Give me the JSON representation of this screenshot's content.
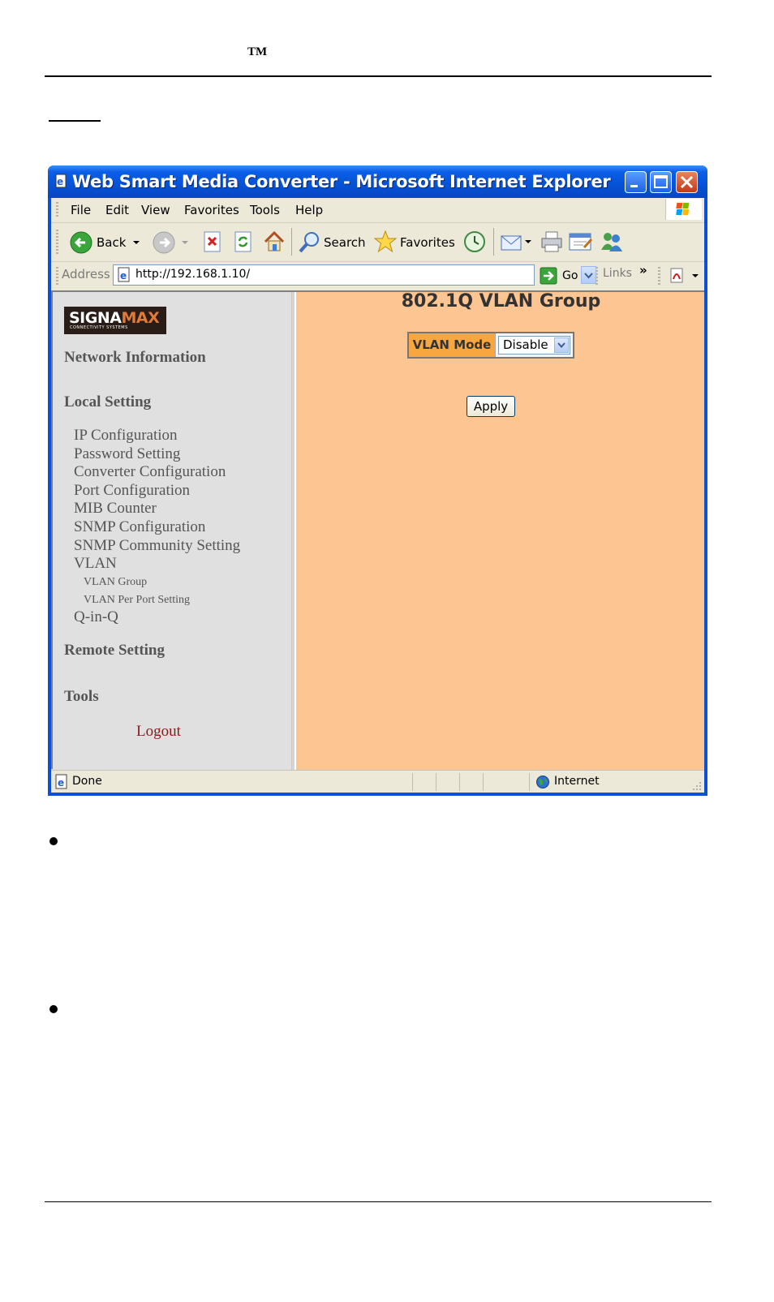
{
  "document": {
    "trademark": "TM"
  },
  "window": {
    "title": "Web Smart Media Converter - Microsoft Internet Explorer"
  },
  "menubar": {
    "items": [
      "File",
      "Edit",
      "View",
      "Favorites",
      "Tools",
      "Help"
    ]
  },
  "toolbar": {
    "back_label": "Back",
    "search_label": "Search",
    "favorites_label": "Favorites"
  },
  "addressbar": {
    "label": "Address",
    "url": "http://192.168.1.10/",
    "go_label": "Go",
    "links_label": "Links",
    "chevron": "»"
  },
  "sidebar": {
    "logo_main_white": "SIGNA",
    "logo_main_orange": "MAX",
    "logo_sub": "CONNECTIVITY SYSTEMS",
    "network_information": "Network Information",
    "local_setting": "Local Setting",
    "local_items": [
      "IP Configuration",
      "Password Setting",
      "Converter Configuration",
      "Port Configuration",
      "MIB Counter",
      "SNMP Configuration",
      "SNMP Community Setting",
      "VLAN"
    ],
    "vlan_items": [
      "VLAN Group",
      "VLAN Per Port Setting"
    ],
    "qinq": "Q-in-Q",
    "remote_setting": "Remote Setting",
    "tools": "Tools",
    "logout": "Logout"
  },
  "main": {
    "heading": "802.1Q VLAN Group",
    "vlan_mode_label": "VLAN Mode",
    "vlan_mode_value": "Disable",
    "apply_label": "Apply"
  },
  "statusbar": {
    "status": "Done",
    "zone": "Internet"
  },
  "colors": {
    "main_background": "#fdc592",
    "vlan_label_background": "#f7a640",
    "logout_color": "#8b1a1a",
    "ie_titlebar": "#0552d6"
  }
}
